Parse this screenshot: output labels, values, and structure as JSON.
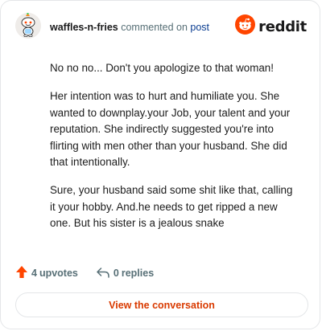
{
  "header": {
    "username": "waffles-n-fries",
    "action_text": "commented on",
    "post_link": "post",
    "brand": "reddit",
    "avatar_icon": "snoo-avatar-icon",
    "brand_icon": "reddit-snoo-logo-icon"
  },
  "comment": {
    "paragraphs": [
      "No no no... Don't you apologize to that woman!",
      "Her intention was to hurt and humiliate you. She wanted to downplay.your Job, your talent and your reputation. She indirectly suggested you're into flirting with men other than your husband. She did that intentionally.",
      "Sure, your husband said some shit like that, calling it your hobby. And.he needs to get ripped a new one. But his sister is a jealous snake"
    ]
  },
  "footer": {
    "upvotes_count": "4",
    "upvotes_label": "upvotes",
    "replies_count": "0",
    "replies_label": "replies",
    "upvote_icon": "upvote-arrow-icon",
    "reply_icon": "reply-arrow-icon"
  },
  "cta": {
    "label": "View the conversation"
  },
  "colors": {
    "accent": "#d93a00",
    "brand": "#ff4500",
    "link": "#0a3d91",
    "muted": "#576f76",
    "border": "#e4e6e8"
  }
}
